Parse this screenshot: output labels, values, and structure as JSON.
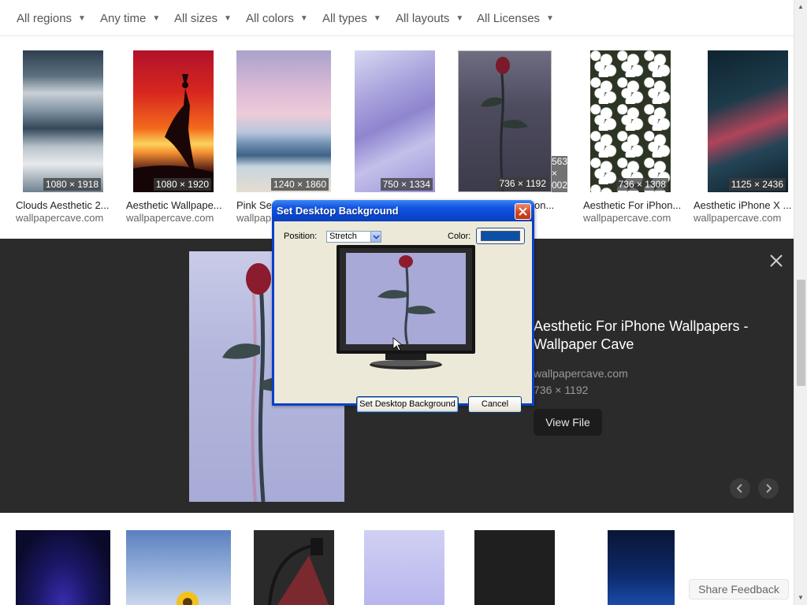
{
  "filters": [
    {
      "label": "All regions"
    },
    {
      "label": "Any time"
    },
    {
      "label": "All sizes"
    },
    {
      "label": "All colors"
    },
    {
      "label": "All types"
    },
    {
      "label": "All layouts"
    },
    {
      "label": "All Licenses"
    }
  ],
  "results_row1": [
    {
      "title": "Clouds Aesthetic 2...",
      "source": "wallpapercave.com",
      "dims": "1080 × 1918"
    },
    {
      "title": "Aesthetic Wallpape...",
      "source": "wallpapercave.com",
      "dims": "1080 × 1920"
    },
    {
      "title": "Pink Se",
      "source": "wallpap",
      "dims": "1240 × 1860"
    },
    {
      "title": "",
      "source": "",
      "dims": "750 × 1334"
    },
    {
      "title": "on...",
      "source": "",
      "dims": "736 × 1192"
    },
    {
      "title": "Aesthetic For iPhon...",
      "source": "wallpapercave.com",
      "dims": "736 × 1308"
    },
    {
      "title": "Aesthetic iPhone X ...",
      "source": "wallpapercave.com",
      "dims": "1125 × 2436"
    }
  ],
  "partial_dims": {
    "line1": "563",
    "line2": "×",
    "line3": "002"
  },
  "preview": {
    "title": "Aesthetic For iPhone Wallpapers - Wallpaper Cave",
    "source": "wallpapercave.com",
    "dims": "736 × 1192",
    "view_file_label": "View File"
  },
  "dialog": {
    "title": "Set Desktop Background",
    "position_label": "Position:",
    "position_value": "Stretch",
    "color_label": "Color:",
    "color_value": "#0b4fa6",
    "set_button_label": "Set Desktop Background",
    "cancel_button_label": "Cancel"
  },
  "share_feedback_label": "Share Feedback",
  "colors": {
    "preview_bg": "#2b2b2b",
    "xp_title_blue": "#0a48d4",
    "xp_dialog_face": "#ece9d8"
  }
}
